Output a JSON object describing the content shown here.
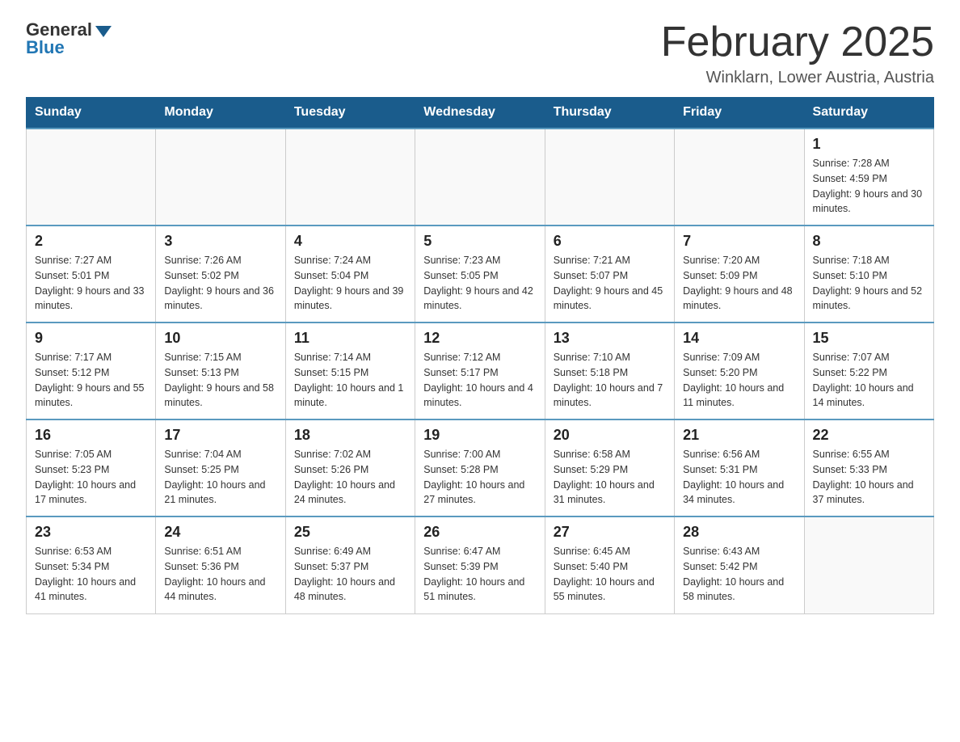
{
  "logo": {
    "general": "General",
    "blue": "Blue"
  },
  "title": "February 2025",
  "location": "Winklarn, Lower Austria, Austria",
  "days_of_week": [
    "Sunday",
    "Monday",
    "Tuesday",
    "Wednesday",
    "Thursday",
    "Friday",
    "Saturday"
  ],
  "weeks": [
    [
      {
        "day": "",
        "info": ""
      },
      {
        "day": "",
        "info": ""
      },
      {
        "day": "",
        "info": ""
      },
      {
        "day": "",
        "info": ""
      },
      {
        "day": "",
        "info": ""
      },
      {
        "day": "",
        "info": ""
      },
      {
        "day": "1",
        "info": "Sunrise: 7:28 AM\nSunset: 4:59 PM\nDaylight: 9 hours and 30 minutes."
      }
    ],
    [
      {
        "day": "2",
        "info": "Sunrise: 7:27 AM\nSunset: 5:01 PM\nDaylight: 9 hours and 33 minutes."
      },
      {
        "day": "3",
        "info": "Sunrise: 7:26 AM\nSunset: 5:02 PM\nDaylight: 9 hours and 36 minutes."
      },
      {
        "day": "4",
        "info": "Sunrise: 7:24 AM\nSunset: 5:04 PM\nDaylight: 9 hours and 39 minutes."
      },
      {
        "day": "5",
        "info": "Sunrise: 7:23 AM\nSunset: 5:05 PM\nDaylight: 9 hours and 42 minutes."
      },
      {
        "day": "6",
        "info": "Sunrise: 7:21 AM\nSunset: 5:07 PM\nDaylight: 9 hours and 45 minutes."
      },
      {
        "day": "7",
        "info": "Sunrise: 7:20 AM\nSunset: 5:09 PM\nDaylight: 9 hours and 48 minutes."
      },
      {
        "day": "8",
        "info": "Sunrise: 7:18 AM\nSunset: 5:10 PM\nDaylight: 9 hours and 52 minutes."
      }
    ],
    [
      {
        "day": "9",
        "info": "Sunrise: 7:17 AM\nSunset: 5:12 PM\nDaylight: 9 hours and 55 minutes."
      },
      {
        "day": "10",
        "info": "Sunrise: 7:15 AM\nSunset: 5:13 PM\nDaylight: 9 hours and 58 minutes."
      },
      {
        "day": "11",
        "info": "Sunrise: 7:14 AM\nSunset: 5:15 PM\nDaylight: 10 hours and 1 minute."
      },
      {
        "day": "12",
        "info": "Sunrise: 7:12 AM\nSunset: 5:17 PM\nDaylight: 10 hours and 4 minutes."
      },
      {
        "day": "13",
        "info": "Sunrise: 7:10 AM\nSunset: 5:18 PM\nDaylight: 10 hours and 7 minutes."
      },
      {
        "day": "14",
        "info": "Sunrise: 7:09 AM\nSunset: 5:20 PM\nDaylight: 10 hours and 11 minutes."
      },
      {
        "day": "15",
        "info": "Sunrise: 7:07 AM\nSunset: 5:22 PM\nDaylight: 10 hours and 14 minutes."
      }
    ],
    [
      {
        "day": "16",
        "info": "Sunrise: 7:05 AM\nSunset: 5:23 PM\nDaylight: 10 hours and 17 minutes."
      },
      {
        "day": "17",
        "info": "Sunrise: 7:04 AM\nSunset: 5:25 PM\nDaylight: 10 hours and 21 minutes."
      },
      {
        "day": "18",
        "info": "Sunrise: 7:02 AM\nSunset: 5:26 PM\nDaylight: 10 hours and 24 minutes."
      },
      {
        "day": "19",
        "info": "Sunrise: 7:00 AM\nSunset: 5:28 PM\nDaylight: 10 hours and 27 minutes."
      },
      {
        "day": "20",
        "info": "Sunrise: 6:58 AM\nSunset: 5:29 PM\nDaylight: 10 hours and 31 minutes."
      },
      {
        "day": "21",
        "info": "Sunrise: 6:56 AM\nSunset: 5:31 PM\nDaylight: 10 hours and 34 minutes."
      },
      {
        "day": "22",
        "info": "Sunrise: 6:55 AM\nSunset: 5:33 PM\nDaylight: 10 hours and 37 minutes."
      }
    ],
    [
      {
        "day": "23",
        "info": "Sunrise: 6:53 AM\nSunset: 5:34 PM\nDaylight: 10 hours and 41 minutes."
      },
      {
        "day": "24",
        "info": "Sunrise: 6:51 AM\nSunset: 5:36 PM\nDaylight: 10 hours and 44 minutes."
      },
      {
        "day": "25",
        "info": "Sunrise: 6:49 AM\nSunset: 5:37 PM\nDaylight: 10 hours and 48 minutes."
      },
      {
        "day": "26",
        "info": "Sunrise: 6:47 AM\nSunset: 5:39 PM\nDaylight: 10 hours and 51 minutes."
      },
      {
        "day": "27",
        "info": "Sunrise: 6:45 AM\nSunset: 5:40 PM\nDaylight: 10 hours and 55 minutes."
      },
      {
        "day": "28",
        "info": "Sunrise: 6:43 AM\nSunset: 5:42 PM\nDaylight: 10 hours and 58 minutes."
      },
      {
        "day": "",
        "info": ""
      }
    ]
  ]
}
